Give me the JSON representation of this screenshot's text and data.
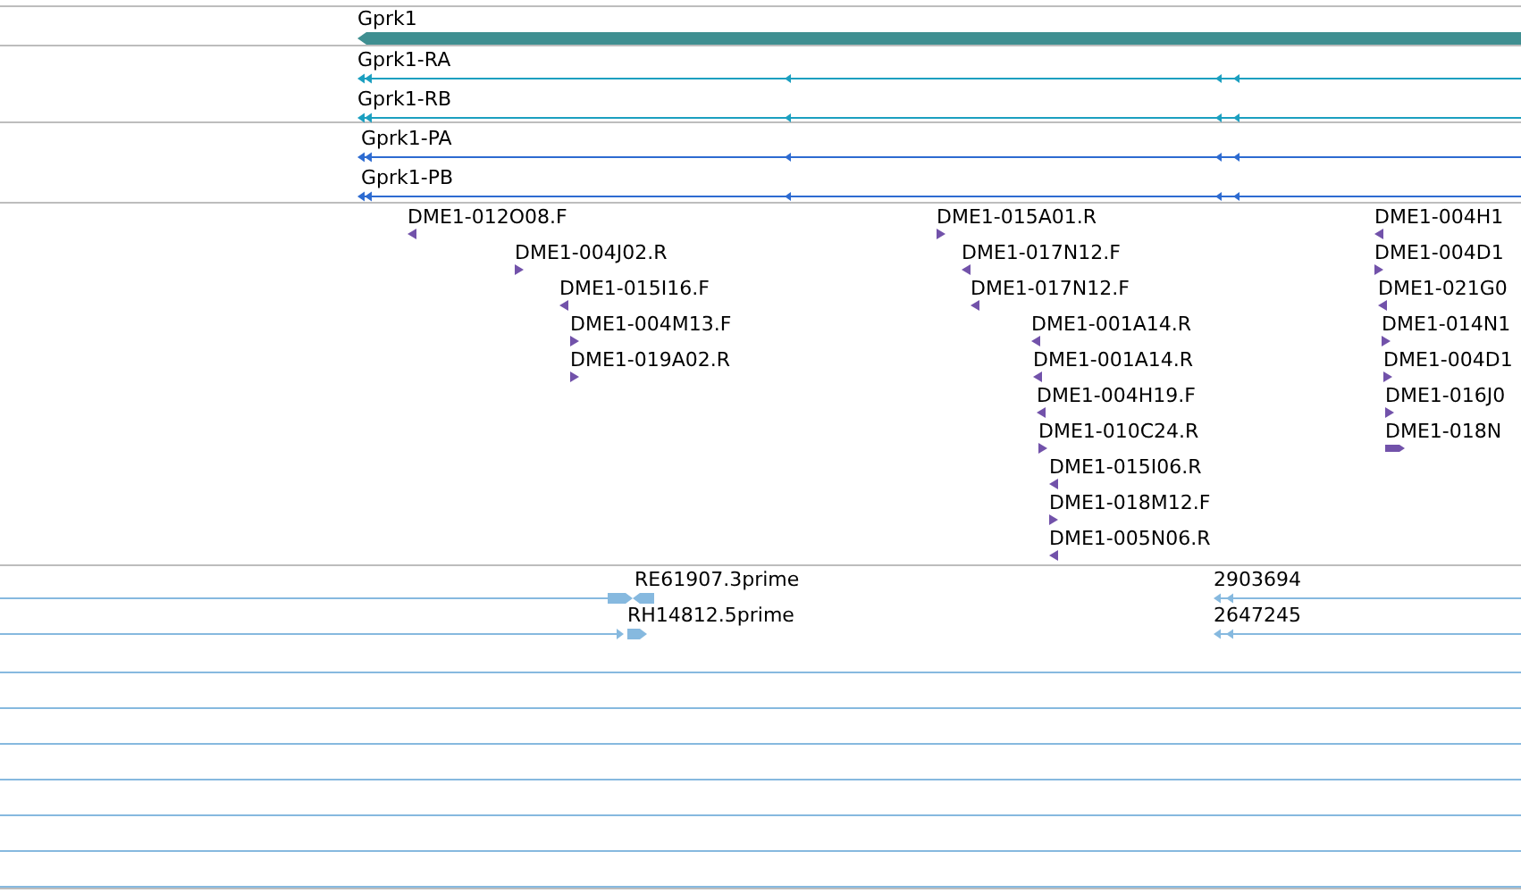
{
  "gene_track": {
    "features": [
      {
        "label": "Gprk1",
        "reverse": true
      }
    ]
  },
  "transcript_track": {
    "features": [
      {
        "label": "Gprk1-RA",
        "reverse": true
      },
      {
        "label": "Gprk1-RB",
        "reverse": true
      }
    ]
  },
  "protein_track": {
    "features": [
      {
        "label": "Gprk1-PA",
        "reverse": true
      },
      {
        "label": "Gprk1-PB",
        "reverse": true
      }
    ]
  },
  "clone_end_track": {
    "features": [
      {
        "label": "DME1-012O08.F",
        "reverse": true
      },
      {
        "label": "DME1-004J02.R",
        "reverse": false
      },
      {
        "label": "DME1-015I16.F",
        "reverse": true
      },
      {
        "label": "DME1-004M13.F",
        "reverse": false
      },
      {
        "label": "DME1-019A02.R",
        "reverse": false
      },
      {
        "label": "DME1-015A01.R",
        "reverse": false
      },
      {
        "label": "DME1-017N12.F",
        "reverse": true
      },
      {
        "label": "DME1-017N12.F",
        "reverse": true
      },
      {
        "label": "DME1-001A14.R",
        "reverse": true
      },
      {
        "label": "DME1-001A14.R",
        "reverse": true
      },
      {
        "label": "DME1-004H19.F",
        "reverse": true
      },
      {
        "label": "DME1-010C24.R",
        "reverse": false
      },
      {
        "label": "DME1-015I06.R",
        "reverse": true
      },
      {
        "label": "DME1-018M12.F",
        "reverse": false
      },
      {
        "label": "DME1-005N06.R",
        "reverse": true
      },
      {
        "label": "DME1-004H1",
        "reverse": true
      },
      {
        "label": "DME1-004D1",
        "reverse": false
      },
      {
        "label": "DME1-021G0",
        "reverse": true
      },
      {
        "label": "DME1-014N1",
        "reverse": false
      },
      {
        "label": "DME1-004D1",
        "reverse": false
      },
      {
        "label": "DME1-016J0",
        "reverse": false
      },
      {
        "label": "DME1-018N",
        "reverse": false
      }
    ]
  },
  "alignment_track": {
    "rows": [
      {
        "features": [
          {
            "label": "RE61907.3prime",
            "reverse": true
          },
          {
            "label": "2903694",
            "reverse": true
          }
        ]
      },
      {
        "features": [
          {
            "label": "RH14812.5prime",
            "reverse": false
          },
          {
            "label": "2647245",
            "reverse": true
          }
        ]
      }
    ]
  }
}
